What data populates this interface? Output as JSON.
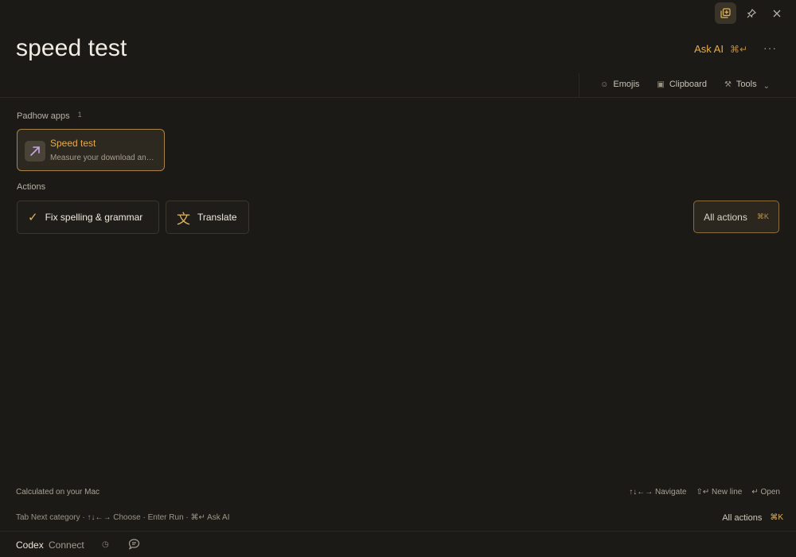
{
  "window_controls": {
    "icons": [
      "copy-icon",
      "pin-icon",
      "close-icon"
    ]
  },
  "header": {
    "query": "speed test",
    "ask_ai_label": "Ask AI",
    "ask_ai_shortcut": "⌘↵",
    "more_label": "···"
  },
  "toolbar": {
    "items": [
      {
        "label": "Emojis",
        "icon": "☺"
      },
      {
        "label": "Clipboard",
        "icon": "▣"
      },
      {
        "label": "Tools",
        "icon": "⚒"
      }
    ],
    "tools_chevron": "⌄"
  },
  "apps_section": {
    "label": "Padhow apps",
    "count": "1",
    "items": [
      {
        "title": "Speed test",
        "subtitle": "Measure your download and upload speed"
      }
    ]
  },
  "actions_section": {
    "label": "Actions",
    "items": [
      {
        "label": "Fix spelling & grammar",
        "icon": "✓"
      },
      {
        "label": "Translate",
        "icon": "文"
      }
    ],
    "all_actions_label": "All actions",
    "all_actions_shortcut": "⌘K"
  },
  "status": {
    "calculated": "Calculated on your Mac",
    "hints": [
      "↑↓←→ Navigate",
      "⇧↵ New line",
      "↵ Open"
    ],
    "keyboard_help": "Tab Next category · ↑↓←→ Choose · Enter Run · ⌘↵ Ask AI",
    "all_actions_label": "All actions",
    "all_actions_shortcut": "⌘K"
  },
  "bottom_bar": {
    "codex": "Codex",
    "connect": "Connect",
    "history_icon": "◷",
    "chat_icon": "chat-icon"
  },
  "colors": {
    "background": "#1c1a17",
    "accent": "#e6ab4c",
    "card_border": "#a8834a"
  }
}
